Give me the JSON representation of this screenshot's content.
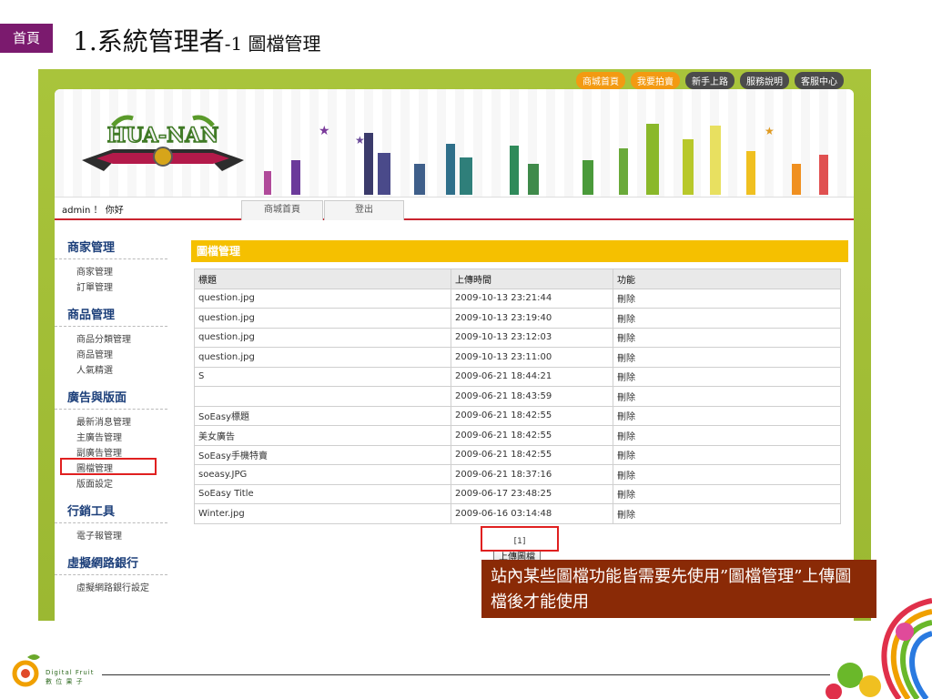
{
  "slide": {
    "home_label": "首頁",
    "title_main": "1.系統管理者",
    "title_sub": "-1 圖檔管理",
    "note_text": "站內某些圖檔功能皆需要先使用”圖檔管理”上傳圖檔後才能使用",
    "footer_brand_line1": "Digital Fruit",
    "footer_brand_line2": "數 位 果 子"
  },
  "site": {
    "logo_text": "HUA-NAN",
    "top_nav": [
      "商城首頁",
      "我要拍賣",
      "新手上路",
      "服務說明",
      "客服中心"
    ],
    "greeting": "admin ！ 你好",
    "tabs": [
      "商城首頁",
      "登出"
    ]
  },
  "sidebar": {
    "sections": [
      {
        "title": "商家管理",
        "items": [
          "商家管理",
          "訂單管理"
        ]
      },
      {
        "title": "商品管理",
        "items": [
          "商品分類管理",
          "商品管理",
          "人氣精選"
        ]
      },
      {
        "title": "廣告與版面",
        "items": [
          "最新消息管理",
          "主廣告管理",
          "副廣告管理",
          "圖檔管理",
          "版面設定"
        ]
      },
      {
        "title": "行銷工具",
        "items": [
          "電子報管理"
        ]
      },
      {
        "title": "虛擬網路銀行",
        "items": [
          "虛擬網路銀行設定"
        ]
      }
    ]
  },
  "main": {
    "header": "圖檔管理",
    "columns": [
      "標題",
      "上傳時間",
      "功能"
    ],
    "rows": [
      [
        "question.jpg",
        "2009-10-13 23:21:44",
        "刪除"
      ],
      [
        "question.jpg",
        "2009-10-13 23:19:40",
        "刪除"
      ],
      [
        "question.jpg",
        "2009-10-13 23:12:03",
        "刪除"
      ],
      [
        "question.jpg",
        "2009-10-13 23:11:00",
        "刪除"
      ],
      [
        "S",
        "2009-06-21 18:44:21",
        "刪除"
      ],
      [
        "",
        "2009-06-21 18:43:59",
        "刪除"
      ],
      [
        "SoEasy標題",
        "2009-06-21 18:42:55",
        "刪除"
      ],
      [
        "美女廣告",
        "2009-06-21 18:42:55",
        "刪除"
      ],
      [
        "SoEasy手機特賣",
        "2009-06-21 18:42:55",
        "刪除"
      ],
      [
        "soeasy.JPG",
        "2009-06-21 18:37:16",
        "刪除"
      ],
      [
        "SoEasy Title",
        "2009-06-17 23:48:25",
        "刪除"
      ],
      [
        "Winter.jpg",
        "2009-06-16 03:14:48",
        "刪除"
      ]
    ],
    "pager": "[1]",
    "upload_label": "上傳圖檔"
  },
  "colors": {
    "accent_purple": "#7b1a6e",
    "frame_green": "#a9c43b",
    "header_yellow": "#f5c000",
    "note_brown": "#8a2a06",
    "highlight_red": "#e02020"
  }
}
